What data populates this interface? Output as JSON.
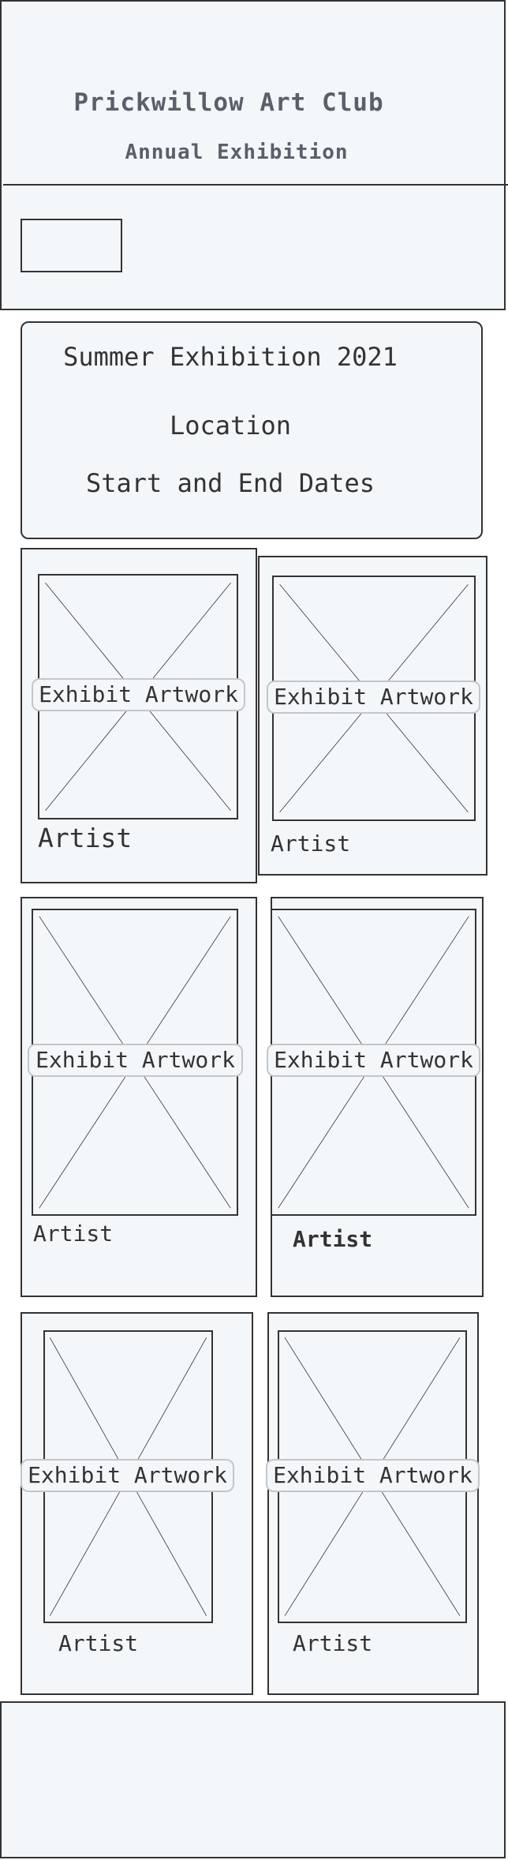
{
  "header": {
    "title": "Prickwillow Art Club",
    "subtitle": "Annual Exhibition"
  },
  "info": {
    "exhibition_name": "Summer Exhibition 2021",
    "location": "Location",
    "dates": "Start and End Dates"
  },
  "gallery": {
    "items": [
      {
        "label": "Exhibit Artwork",
        "artist": "Artist"
      },
      {
        "label": "Exhibit Artwork",
        "artist": "Artist"
      },
      {
        "label": "Exhibit Artwork",
        "artist": "Artist"
      },
      {
        "label": "Exhibit Artwork",
        "artist": "Artist"
      },
      {
        "label": "Exhibit Artwork",
        "artist": "Artist"
      },
      {
        "label": "Exhibit Artwork",
        "artist": "Artist"
      }
    ]
  },
  "colors": {
    "panel_background": "#f4f7fa",
    "stroke": "#333333",
    "header_text": "#59606a"
  }
}
